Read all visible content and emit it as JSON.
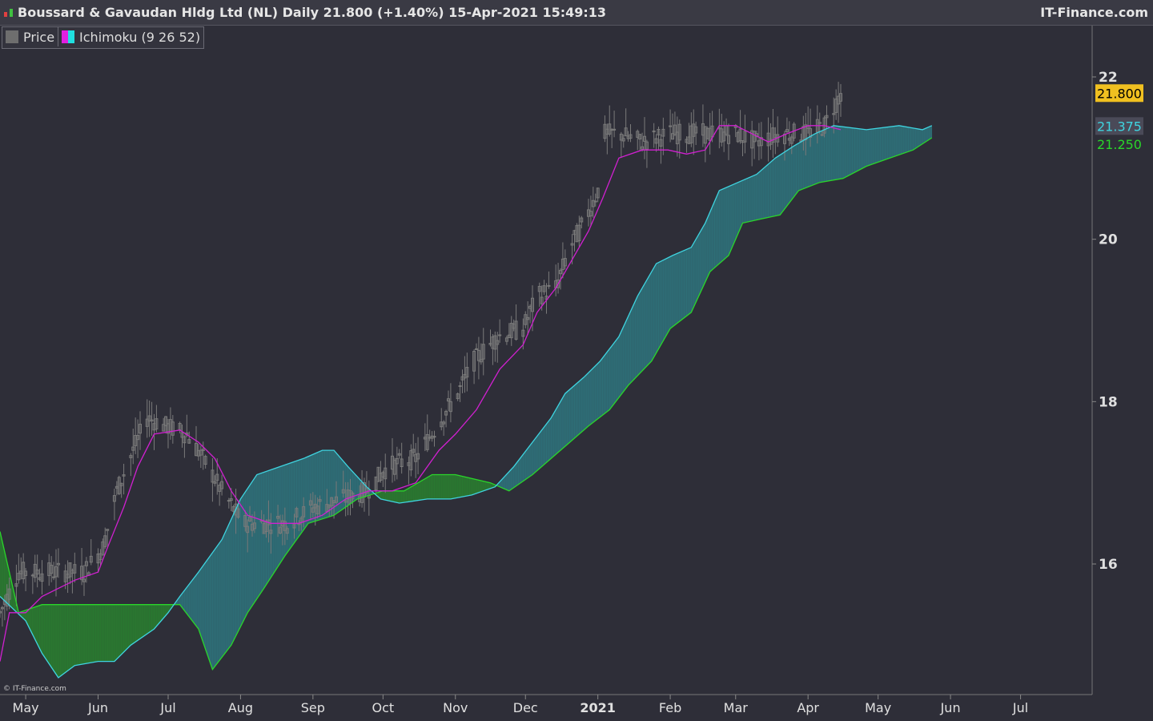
{
  "header": {
    "title": "Boussard & Gavaudan Hldg Ltd (NL) Daily 21.800 (+1.40%) 15-Apr-2021 15:49:13",
    "brand": "IT-Finance.com"
  },
  "legend": {
    "items": [
      {
        "label": "Price",
        "color": "#6e6e6e"
      },
      {
        "label": "Ichimoku (9 26 52)",
        "color_a": "#e020e0",
        "color_b": "#20e0e0"
      }
    ]
  },
  "credit": "© IT-Finance.com",
  "colors": {
    "background": "#2e2e38",
    "candle": "#7a7a7a",
    "tenkan": "#d020d0",
    "senkou_a": "#3fd4e0",
    "senkou_b": "#2ad62a",
    "cloud_up": "#2f6f78",
    "cloud_down": "#2a7a30",
    "last_price_bg": "#f0c020"
  },
  "chart_data": {
    "type": "candlestick-ichimoku",
    "x_axis_labels": [
      "May",
      "Jun",
      "Jul",
      "Aug",
      "Sep",
      "Oct",
      "Nov",
      "Dec",
      "2021",
      "Feb",
      "Mar",
      "Apr",
      "May",
      "Jun",
      "Jul"
    ],
    "x_axis_label_dates": [
      "2020-05-01",
      "2020-06-01",
      "2020-07-01",
      "2020-08-01",
      "2020-09-01",
      "2020-10-01",
      "2020-11-01",
      "2020-12-01",
      "2021-01-01",
      "2021-02-01",
      "2021-03-01",
      "2021-04-01",
      "2021-05-01",
      "2021-06-01",
      "2021-07-01"
    ],
    "y_ticks": [
      16,
      18,
      20,
      22
    ],
    "y_tick_labels": [
      "16",
      "18",
      "20",
      "22"
    ],
    "ylim": [
      14.4,
      22.6
    ],
    "price_markers": [
      {
        "label": "21.800",
        "value": 21.8,
        "style": "last"
      },
      {
        "label": "21.375",
        "value": 21.375,
        "style": "senkou_a"
      },
      {
        "label": "21.250",
        "value": 21.25,
        "style": "senkou_b"
      }
    ],
    "price_segments": [
      {
        "date": "2020-04-20",
        "price": 15.4
      },
      {
        "date": "2020-04-28",
        "price": 15.9
      },
      {
        "date": "2020-05-12",
        "price": 15.9
      },
      {
        "date": "2020-05-26",
        "price": 15.9
      },
      {
        "date": "2020-06-03",
        "price": 16.2
      },
      {
        "date": "2020-06-09",
        "price": 16.9
      },
      {
        "date": "2020-06-16",
        "price": 17.4
      },
      {
        "date": "2020-06-22",
        "price": 17.8
      },
      {
        "date": "2020-06-30",
        "price": 17.7
      },
      {
        "date": "2020-07-09",
        "price": 17.6
      },
      {
        "date": "2020-07-16",
        "price": 17.3
      },
      {
        "date": "2020-07-24",
        "price": 16.9
      },
      {
        "date": "2020-08-02",
        "price": 16.5
      },
      {
        "date": "2020-08-11",
        "price": 16.5
      },
      {
        "date": "2020-08-21",
        "price": 16.5
      },
      {
        "date": "2020-09-01",
        "price": 16.7
      },
      {
        "date": "2020-09-14",
        "price": 16.8
      },
      {
        "date": "2020-09-24",
        "price": 16.9
      },
      {
        "date": "2020-10-03",
        "price": 17.2
      },
      {
        "date": "2020-10-15",
        "price": 17.3
      },
      {
        "date": "2020-10-24",
        "price": 17.7
      },
      {
        "date": "2020-11-02",
        "price": 18.1
      },
      {
        "date": "2020-11-09",
        "price": 18.5
      },
      {
        "date": "2020-11-19",
        "price": 18.8
      },
      {
        "date": "2020-11-30",
        "price": 18.9
      },
      {
        "date": "2020-12-06",
        "price": 19.3
      },
      {
        "date": "2020-12-14",
        "price": 19.4
      },
      {
        "date": "2020-12-20",
        "price": 19.9
      },
      {
        "date": "2020-12-26",
        "price": 20.2
      },
      {
        "date": "2021-01-01",
        "price": 20.6
      },
      {
        "date": "2021-01-04",
        "price": 21.3
      },
      {
        "date": "2021-01-10",
        "price": 21.3
      },
      {
        "date": "2021-01-20",
        "price": 21.2
      },
      {
        "date": "2021-02-01",
        "price": 21.3
      },
      {
        "date": "2021-02-10",
        "price": 21.3
      },
      {
        "date": "2021-02-20",
        "price": 21.3
      },
      {
        "date": "2021-03-01",
        "price": 21.3
      },
      {
        "date": "2021-03-10",
        "price": 21.2
      },
      {
        "date": "2021-03-20",
        "price": 21.3
      },
      {
        "date": "2021-03-31",
        "price": 21.3
      },
      {
        "date": "2021-04-08",
        "price": 21.4
      },
      {
        "date": "2021-04-15",
        "price": 21.8
      }
    ],
    "series": [
      {
        "name": "Tenkan",
        "points": [
          [
            "2020-04-20",
            14.8
          ],
          [
            "2020-04-24",
            15.4
          ],
          [
            "2020-05-01",
            15.4
          ],
          [
            "2020-05-08",
            15.6
          ],
          [
            "2020-05-22",
            15.8
          ],
          [
            "2020-06-01",
            15.9
          ],
          [
            "2020-06-05",
            16.2
          ],
          [
            "2020-06-12",
            16.7
          ],
          [
            "2020-06-18",
            17.2
          ],
          [
            "2020-06-25",
            17.6
          ],
          [
            "2020-07-06",
            17.65
          ],
          [
            "2020-07-14",
            17.5
          ],
          [
            "2020-07-21",
            17.3
          ],
          [
            "2020-07-28",
            16.9
          ],
          [
            "2020-08-04",
            16.6
          ],
          [
            "2020-08-14",
            16.5
          ],
          [
            "2020-08-26",
            16.5
          ],
          [
            "2020-09-05",
            16.6
          ],
          [
            "2020-09-15",
            16.8
          ],
          [
            "2020-09-25",
            16.9
          ],
          [
            "2020-10-05",
            16.9
          ],
          [
            "2020-10-15",
            17.0
          ],
          [
            "2020-10-25",
            17.4
          ],
          [
            "2020-11-01",
            17.6
          ],
          [
            "2020-11-10",
            17.9
          ],
          [
            "2020-11-20",
            18.4
          ],
          [
            "2020-11-30",
            18.7
          ],
          [
            "2020-12-06",
            19.1
          ],
          [
            "2020-12-14",
            19.4
          ],
          [
            "2020-12-20",
            19.7
          ],
          [
            "2020-12-28",
            20.1
          ],
          [
            "2021-01-03",
            20.5
          ],
          [
            "2021-01-10",
            21.0
          ],
          [
            "2021-01-20",
            21.1
          ],
          [
            "2021-01-31",
            21.1
          ],
          [
            "2021-02-08",
            21.05
          ],
          [
            "2021-02-16",
            21.1
          ],
          [
            "2021-02-22",
            21.4
          ],
          [
            "2021-03-01",
            21.4
          ],
          [
            "2021-03-08",
            21.3
          ],
          [
            "2021-03-15",
            21.2
          ],
          [
            "2021-03-23",
            21.3
          ],
          [
            "2021-04-01",
            21.4
          ],
          [
            "2021-04-08",
            21.4
          ],
          [
            "2021-04-15",
            21.35
          ]
        ]
      },
      {
        "name": "Senkou A",
        "points": [
          [
            "2020-04-20",
            15.6
          ],
          [
            "2020-05-01",
            15.3
          ],
          [
            "2020-05-08",
            14.9
          ],
          [
            "2020-05-15",
            14.6
          ],
          [
            "2020-05-22",
            14.75
          ],
          [
            "2020-06-01",
            14.8
          ],
          [
            "2020-06-08",
            14.8
          ],
          [
            "2020-06-15",
            15.0
          ],
          [
            "2020-06-25",
            15.2
          ],
          [
            "2020-07-01",
            15.4
          ],
          [
            "2020-07-06",
            15.6
          ],
          [
            "2020-07-14",
            15.9
          ],
          [
            "2020-07-24",
            16.3
          ],
          [
            "2020-08-01",
            16.8
          ],
          [
            "2020-08-08",
            17.1
          ],
          [
            "2020-08-18",
            17.2
          ],
          [
            "2020-08-28",
            17.3
          ],
          [
            "2020-09-05",
            17.4
          ],
          [
            "2020-09-10",
            17.4
          ],
          [
            "2020-09-16",
            17.2
          ],
          [
            "2020-09-24",
            16.95
          ],
          [
            "2020-09-30",
            16.8
          ],
          [
            "2020-10-08",
            16.75
          ],
          [
            "2020-10-20",
            16.8
          ],
          [
            "2020-10-30",
            16.8
          ],
          [
            "2020-11-08",
            16.85
          ],
          [
            "2020-11-18",
            16.95
          ],
          [
            "2020-11-26",
            17.2
          ],
          [
            "2020-12-04",
            17.5
          ],
          [
            "2020-12-12",
            17.8
          ],
          [
            "2020-12-18",
            18.1
          ],
          [
            "2020-12-26",
            18.3
          ],
          [
            "2021-01-02",
            18.5
          ],
          [
            "2021-01-10",
            18.8
          ],
          [
            "2021-01-18",
            19.3
          ],
          [
            "2021-01-26",
            19.7
          ],
          [
            "2021-02-02",
            19.8
          ],
          [
            "2021-02-10",
            19.9
          ],
          [
            "2021-02-16",
            20.2
          ],
          [
            "2021-02-22",
            20.6
          ],
          [
            "2021-03-02",
            20.7
          ],
          [
            "2021-03-10",
            20.8
          ],
          [
            "2021-03-18",
            21.0
          ],
          [
            "2021-03-26",
            21.15
          ],
          [
            "2021-04-04",
            21.3
          ],
          [
            "2021-04-12",
            21.4
          ],
          [
            "2021-04-26",
            21.35
          ],
          [
            "2021-05-10",
            21.4
          ],
          [
            "2021-05-20",
            21.35
          ],
          [
            "2021-05-24",
            21.4
          ]
        ]
      },
      {
        "name": "Senkou B",
        "points": [
          [
            "2020-04-20",
            16.4
          ],
          [
            "2020-04-28",
            15.4
          ],
          [
            "2020-05-08",
            15.5
          ],
          [
            "2020-06-01",
            15.5
          ],
          [
            "2020-06-20",
            15.5
          ],
          [
            "2020-07-06",
            15.5
          ],
          [
            "2020-07-14",
            15.2
          ],
          [
            "2020-07-20",
            14.7
          ],
          [
            "2020-07-28",
            15.0
          ],
          [
            "2020-08-04",
            15.4
          ],
          [
            "2020-08-11",
            15.7
          ],
          [
            "2020-08-20",
            16.1
          ],
          [
            "2020-08-30",
            16.5
          ],
          [
            "2020-09-10",
            16.6
          ],
          [
            "2020-09-20",
            16.8
          ],
          [
            "2020-10-01",
            16.9
          ],
          [
            "2020-10-10",
            16.9
          ],
          [
            "2020-10-22",
            17.1
          ],
          [
            "2020-11-01",
            17.1
          ],
          [
            "2020-11-16",
            17.0
          ],
          [
            "2020-11-24",
            16.9
          ],
          [
            "2020-12-04",
            17.1
          ],
          [
            "2020-12-12",
            17.3
          ],
          [
            "2020-12-20",
            17.5
          ],
          [
            "2020-12-28",
            17.7
          ],
          [
            "2021-01-06",
            17.9
          ],
          [
            "2021-01-14",
            18.2
          ],
          [
            "2021-01-24",
            18.5
          ],
          [
            "2021-02-01",
            18.9
          ],
          [
            "2021-02-10",
            19.1
          ],
          [
            "2021-02-18",
            19.6
          ],
          [
            "2021-02-26",
            19.8
          ],
          [
            "2021-03-04",
            20.2
          ],
          [
            "2021-03-12",
            20.25
          ],
          [
            "2021-03-20",
            20.3
          ],
          [
            "2021-03-28",
            20.6
          ],
          [
            "2021-04-06",
            20.7
          ],
          [
            "2021-04-16",
            20.75
          ],
          [
            "2021-04-26",
            20.9
          ],
          [
            "2021-05-06",
            21.0
          ],
          [
            "2021-05-16",
            21.1
          ],
          [
            "2021-05-24",
            21.25
          ]
        ]
      }
    ]
  }
}
